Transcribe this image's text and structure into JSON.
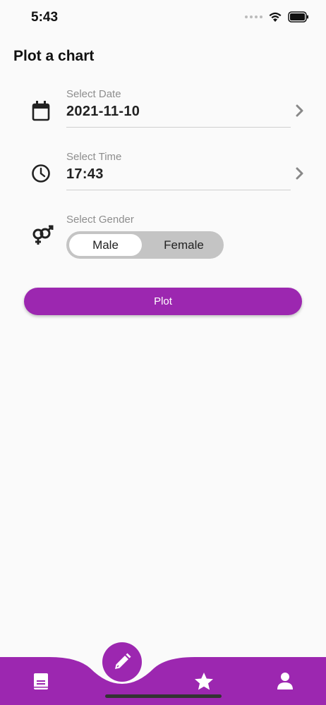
{
  "status_bar": {
    "time": "5:43",
    "icons": [
      "signal-dots-icon",
      "wifi-icon",
      "battery-icon"
    ]
  },
  "page": {
    "title": "Plot a chart"
  },
  "date_field": {
    "label": "Select Date",
    "value": "2021-11-10",
    "icon": "calendar-icon"
  },
  "time_field": {
    "label": "Select Time",
    "value": "17:43",
    "icon": "clock-icon"
  },
  "gender_field": {
    "label": "Select Gender",
    "options": [
      "Male",
      "Female"
    ],
    "selected": "Male",
    "icon": "gender-icon"
  },
  "plot_button": {
    "label": "Plot"
  },
  "bottom_nav": {
    "items": [
      "book-icon",
      "edit-icon",
      "star-icon",
      "user-icon"
    ],
    "active": "edit-icon"
  },
  "colors": {
    "accent": "#9c27b0",
    "background": "#fafafa",
    "toggle_track": "#c4c4c4"
  }
}
